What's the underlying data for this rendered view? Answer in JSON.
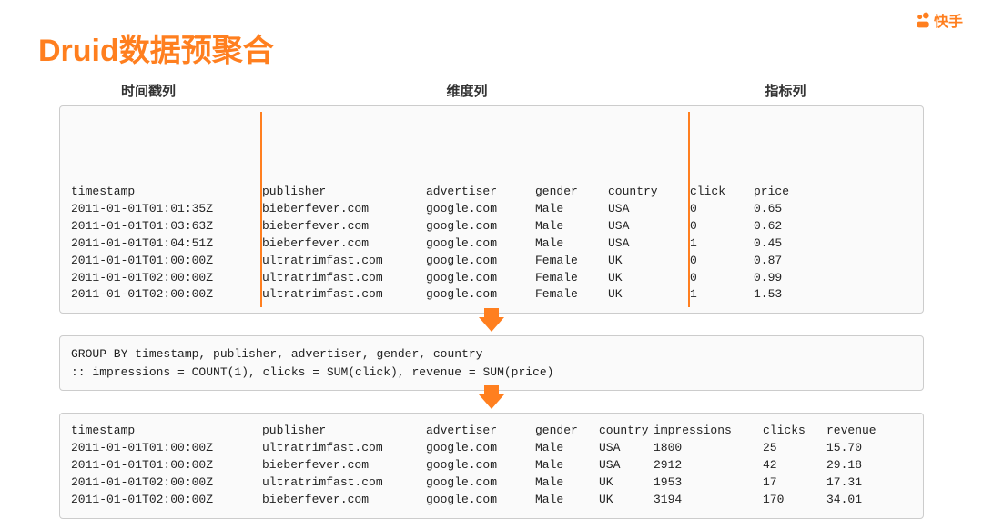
{
  "title": "Druid数据预聚合",
  "logo_text": "快手",
  "section_labels": {
    "timestamp": "时间戳列",
    "dimension": "维度列",
    "metric": "指标列"
  },
  "table1": {
    "headers": [
      "timestamp",
      "publisher",
      "advertiser",
      "gender",
      "country",
      "click",
      "price"
    ],
    "rows": [
      [
        "2011-01-01T01:01:35Z",
        "bieberfever.com",
        "google.com",
        "Male",
        "USA",
        "0",
        "0.65"
      ],
      [
        "2011-01-01T01:03:63Z",
        "bieberfever.com",
        "google.com",
        "Male",
        "USA",
        "0",
        "0.62"
      ],
      [
        "2011-01-01T01:04:51Z",
        "bieberfever.com",
        "google.com",
        "Male",
        "USA",
        "1",
        "0.45"
      ],
      [
        "2011-01-01T01:00:00Z",
        "ultratrimfast.com",
        "google.com",
        "Female",
        "UK",
        "0",
        "0.87"
      ],
      [
        "2011-01-01T02:00:00Z",
        "ultratrimfast.com",
        "google.com",
        "Female",
        "UK",
        "0",
        "0.99"
      ],
      [
        "2011-01-01T02:00:00Z",
        "ultratrimfast.com",
        "google.com",
        "Female",
        "UK",
        "1",
        "1.53"
      ]
    ]
  },
  "groupby": {
    "line1": "GROUP BY timestamp, publisher, advertiser, gender, country",
    "line2": "  :: impressions = COUNT(1),  clicks = SUM(click),  revenue = SUM(price)"
  },
  "table2": {
    "headers": [
      "timestamp",
      "publisher",
      "advertiser",
      "gender",
      "country",
      "impressions",
      "clicks",
      "revenue"
    ],
    "rows": [
      [
        "2011-01-01T01:00:00Z",
        "ultratrimfast.com",
        "google.com",
        "Male",
        "USA",
        "1800",
        "25",
        "15.70"
      ],
      [
        "2011-01-01T01:00:00Z",
        "bieberfever.com",
        "google.com",
        "Male",
        "USA",
        "2912",
        "42",
        "29.18"
      ],
      [
        "2011-01-01T02:00:00Z",
        "ultratrimfast.com",
        "google.com",
        "Male",
        "UK",
        "1953",
        "17",
        "17.31"
      ],
      [
        "2011-01-01T02:00:00Z",
        "bieberfever.com",
        "google.com",
        "Male",
        "UK",
        "3194",
        "170",
        "34.01"
      ]
    ]
  }
}
